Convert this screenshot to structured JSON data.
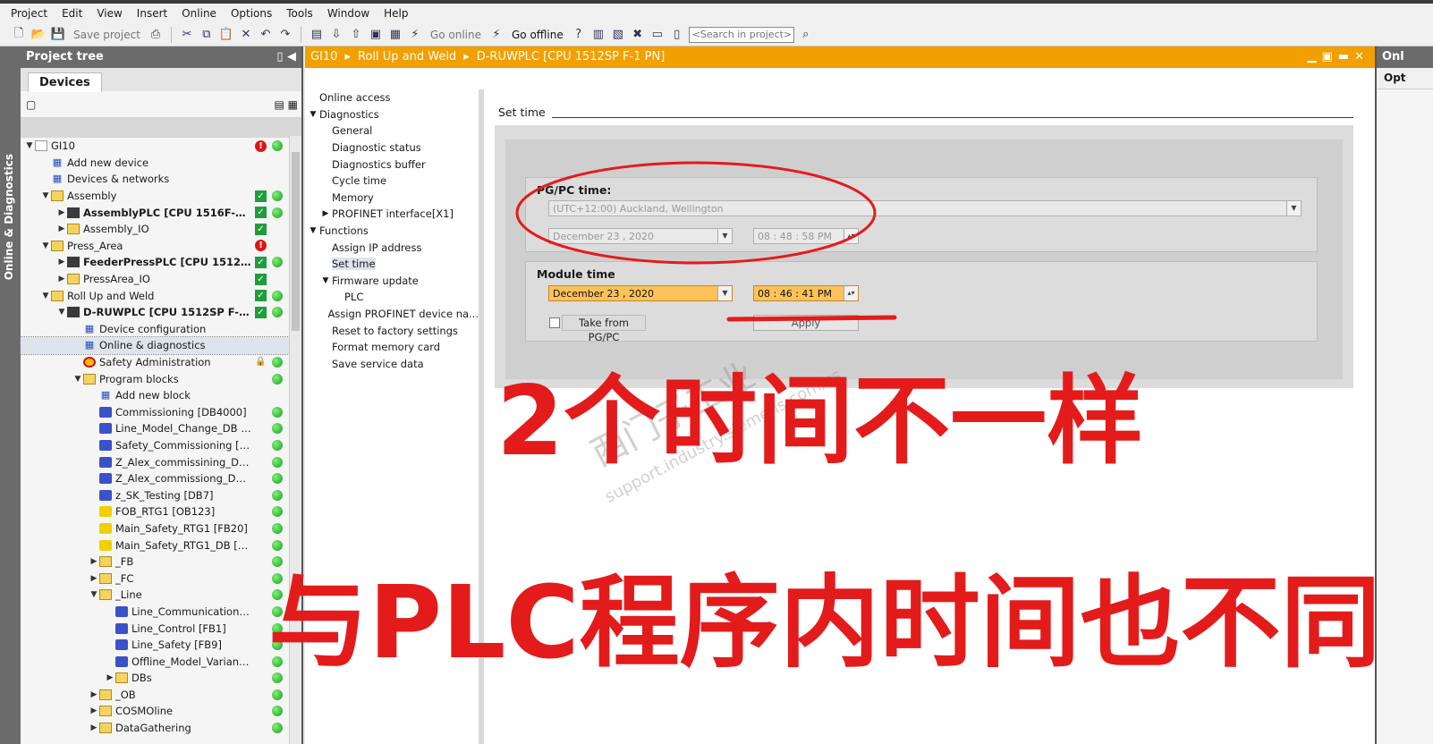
{
  "menu": [
    "Project",
    "Edit",
    "View",
    "Insert",
    "Online",
    "Options",
    "Tools",
    "Window",
    "Help"
  ],
  "toolbar": {
    "save_label": "Save project",
    "go_online": "Go online",
    "go_offline": "Go offline",
    "search_placeholder": "<Search in project>"
  },
  "side_strip_label": "Online & Diagnostics",
  "project_tree": {
    "title": "Project tree",
    "tab": "Devices",
    "items": [
      {
        "depth": 0,
        "arrow": "▼",
        "icon": "doc",
        "label": "GI10",
        "bold": false,
        "st1": "err",
        "st2": "grn"
      },
      {
        "depth": 1,
        "arrow": "",
        "icon": "dev",
        "label": "Add new device",
        "bold": false,
        "st1": "",
        "st2": ""
      },
      {
        "depth": 1,
        "arrow": "",
        "icon": "dev",
        "label": "Devices & networks",
        "bold": false,
        "st1": "",
        "st2": ""
      },
      {
        "depth": 1,
        "arrow": "▼",
        "icon": "folder",
        "label": "Assembly",
        "bold": false,
        "st1": "chk",
        "st2": "grn"
      },
      {
        "depth": 2,
        "arrow": "▶",
        "icon": "plc",
        "label": "AssemblyPLC [CPU 1516F-3 PN/...",
        "bold": true,
        "st1": "chk",
        "st2": "grn"
      },
      {
        "depth": 2,
        "arrow": "▶",
        "icon": "folder",
        "label": "Assembly_IO",
        "bold": false,
        "st1": "chk",
        "st2": ""
      },
      {
        "depth": 1,
        "arrow": "▼",
        "icon": "folder",
        "label": "Press_Area",
        "bold": false,
        "st1": "err",
        "st2": ""
      },
      {
        "depth": 2,
        "arrow": "▶",
        "icon": "plc",
        "label": "FeederPressPLC [CPU 1512SP F...",
        "bold": true,
        "st1": "chk",
        "st2": "grn"
      },
      {
        "depth": 2,
        "arrow": "▶",
        "icon": "folder",
        "label": "PressArea_IO",
        "bold": false,
        "st1": "chk",
        "st2": ""
      },
      {
        "depth": 1,
        "arrow": "▼",
        "icon": "folder",
        "label": "Roll Up and Weld",
        "bold": false,
        "st1": "chk",
        "st2": "grn"
      },
      {
        "depth": 2,
        "arrow": "▼",
        "icon": "plc",
        "label": "D-RUWPLC [CPU 1512SP F-1 PN]",
        "bold": true,
        "st1": "chk",
        "st2": "grn"
      },
      {
        "depth": 3,
        "arrow": "",
        "icon": "dev",
        "label": "Device configuration",
        "bold": false,
        "st1": "",
        "st2": ""
      },
      {
        "depth": 3,
        "arrow": "",
        "icon": "dev",
        "label": "Online & diagnostics",
        "bold": false,
        "st1": "",
        "st2": "",
        "sel": true
      },
      {
        "depth": 3,
        "arrow": "",
        "icon": "safety",
        "label": "Safety Administration",
        "bold": false,
        "st1": "lock",
        "st2": "grn"
      },
      {
        "depth": 3,
        "arrow": "▼",
        "icon": "folder",
        "label": "Program blocks",
        "bold": false,
        "st1": "",
        "st2": "grn"
      },
      {
        "depth": 4,
        "arrow": "",
        "icon": "dev",
        "label": "Add new block",
        "bold": false,
        "st1": "",
        "st2": ""
      },
      {
        "depth": 4,
        "arrow": "",
        "icon": "block",
        "label": "Commissioning [DB4000]",
        "bold": false,
        "st1": "",
        "st2": "grn"
      },
      {
        "depth": 4,
        "arrow": "",
        "icon": "block",
        "label": "Line_Model_Change_DB [D...",
        "bold": false,
        "st1": "",
        "st2": "grn"
      },
      {
        "depth": 4,
        "arrow": "",
        "icon": "block",
        "label": "Safety_Commissioning [DB...",
        "bold": false,
        "st1": "",
        "st2": "grn"
      },
      {
        "depth": 4,
        "arrow": "",
        "icon": "block",
        "label": "Z_Alex_commissining_DB ...",
        "bold": false,
        "st1": "",
        "st2": "grn"
      },
      {
        "depth": 4,
        "arrow": "",
        "icon": "block",
        "label": "Z_Alex_commissiong_DB_...",
        "bold": false,
        "st1": "",
        "st2": "grn"
      },
      {
        "depth": 4,
        "arrow": "",
        "icon": "block",
        "label": "z_SK_Testing [DB7]",
        "bold": false,
        "st1": "",
        "st2": "grn"
      },
      {
        "depth": 4,
        "arrow": "",
        "icon": "fblock",
        "label": "FOB_RTG1 [OB123]",
        "bold": false,
        "st1": "",
        "st2": "grn"
      },
      {
        "depth": 4,
        "arrow": "",
        "icon": "fblock",
        "label": "Main_Safety_RTG1 [FB20]",
        "bold": false,
        "st1": "",
        "st2": "grn"
      },
      {
        "depth": 4,
        "arrow": "",
        "icon": "fblock",
        "label": "Main_Safety_RTG1_DB [DB...",
        "bold": false,
        "st1": "",
        "st2": "grn"
      },
      {
        "depth": 4,
        "arrow": "▶",
        "icon": "folder",
        "label": "_FB",
        "bold": false,
        "st1": "",
        "st2": "grn"
      },
      {
        "depth": 4,
        "arrow": "▶",
        "icon": "folder",
        "label": "_FC",
        "bold": false,
        "st1": "",
        "st2": "grn"
      },
      {
        "depth": 4,
        "arrow": "▼",
        "icon": "folder",
        "label": "_Line",
        "bold": false,
        "st1": "",
        "st2": "grn"
      },
      {
        "depth": 5,
        "arrow": "",
        "icon": "fb",
        "label": "Line_Communication [...",
        "bold": false,
        "st1": "",
        "st2": "grn"
      },
      {
        "depth": 5,
        "arrow": "",
        "icon": "fb",
        "label": "Line_Control [FB1]",
        "bold": false,
        "st1": "",
        "st2": "grn"
      },
      {
        "depth": 5,
        "arrow": "",
        "icon": "fb",
        "label": "Line_Safety [FB9]",
        "bold": false,
        "st1": "",
        "st2": "grn"
      },
      {
        "depth": 5,
        "arrow": "",
        "icon": "fb",
        "label": "Offline_Model_Variants...",
        "bold": false,
        "st1": "",
        "st2": "grn"
      },
      {
        "depth": 5,
        "arrow": "▶",
        "icon": "folder",
        "label": "DBs",
        "bold": false,
        "st1": "",
        "st2": "grn"
      },
      {
        "depth": 4,
        "arrow": "▶",
        "icon": "folder",
        "label": "_OB",
        "bold": false,
        "st1": "",
        "st2": "grn"
      },
      {
        "depth": 4,
        "arrow": "▶",
        "icon": "folder",
        "label": "COSMOline",
        "bold": false,
        "st1": "",
        "st2": "grn"
      },
      {
        "depth": 4,
        "arrow": "▶",
        "icon": "folder",
        "label": "DataGathering",
        "bold": false,
        "st1": "",
        "st2": "grn"
      }
    ]
  },
  "editor": {
    "breadcrumb": [
      "GI10",
      "Roll Up and Weld",
      "D-RUWPLC [CPU 1512SP F-1 PN]"
    ],
    "nav": [
      {
        "depth": 0,
        "arrow": "",
        "label": "Online access"
      },
      {
        "depth": 0,
        "arrow": "▼",
        "label": "Diagnostics"
      },
      {
        "depth": 1,
        "arrow": "",
        "label": "General"
      },
      {
        "depth": 1,
        "arrow": "",
        "label": "Diagnostic status"
      },
      {
        "depth": 1,
        "arrow": "",
        "label": "Diagnostics buffer"
      },
      {
        "depth": 1,
        "arrow": "",
        "label": "Cycle time"
      },
      {
        "depth": 1,
        "arrow": "",
        "label": "Memory"
      },
      {
        "depth": 1,
        "arrow": "▶",
        "label": "PROFINET interface[X1]"
      },
      {
        "depth": 0,
        "arrow": "▼",
        "label": "Functions"
      },
      {
        "depth": 1,
        "arrow": "",
        "label": "Assign IP address"
      },
      {
        "depth": 1,
        "arrow": "",
        "label": "Set time",
        "sel": true
      },
      {
        "depth": 1,
        "arrow": "▼",
        "label": "Firmware update"
      },
      {
        "depth": 2,
        "arrow": "",
        "label": "PLC"
      },
      {
        "depth": 1,
        "arrow": "",
        "label": "Assign PROFINET device na..."
      },
      {
        "depth": 1,
        "arrow": "",
        "label": "Reset to factory settings"
      },
      {
        "depth": 1,
        "arrow": "",
        "label": "Format memory card"
      },
      {
        "depth": 1,
        "arrow": "",
        "label": "Save service data"
      }
    ],
    "set_time": {
      "section_title": "Set time",
      "pgpc_title": "PG/PC time:",
      "timezone": "(UTC+12:00) Auckland, Wellington",
      "pgpc_date": "December  23 ,  2020",
      "pgpc_time": "08 : 48 : 58    PM",
      "module_title": "Module time",
      "module_date": "December  23 ,  2020",
      "module_time": "08 : 46 : 41    PM",
      "take_from_label": "Take from PG/PC",
      "apply_label": "Apply"
    }
  },
  "right_panel": {
    "title": "Onl",
    "sub": "Opt"
  },
  "annotation": {
    "line1": "2个时间不一样",
    "line2": "与PLC程序内时间也不同",
    "color": "#e41b1b"
  },
  "watermark": {
    "line1": "西门子工业",
    "line2": "support.industry.siemens.com/cs"
  },
  "colors": {
    "accent_orange": "#f29f00",
    "header_gray": "#6b6b6b",
    "ok_green": "#1e9e3a",
    "error_red": "#e01414"
  }
}
